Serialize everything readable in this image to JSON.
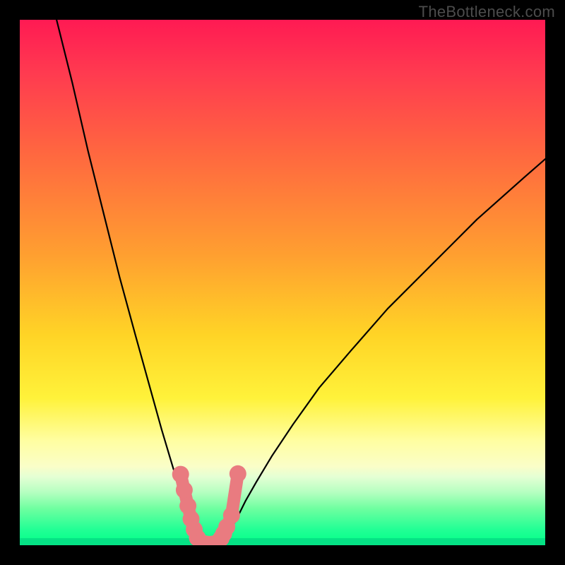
{
  "watermark": {
    "text": "TheBottleneck.com"
  },
  "chart_data": {
    "type": "line",
    "title": "",
    "xlabel": "",
    "ylabel": "",
    "xlim": [
      0,
      100
    ],
    "ylim": [
      0,
      100
    ],
    "series": [
      {
        "name": "curve-left",
        "x": [
          7,
          10,
          13,
          16,
          19,
          22,
          24.5,
          27,
          28.5,
          30,
          31.2,
          32.2,
          32.9,
          33.3
        ],
        "y": [
          100,
          88,
          75,
          63,
          51,
          40,
          31,
          22,
          17,
          12,
          7,
          4,
          1.5,
          0.2
        ],
        "style": "black-thin"
      },
      {
        "name": "curve-right",
        "x": [
          38.7,
          39.3,
          40.2,
          41.5,
          43.0,
          45.0,
          48.0,
          52.0,
          57.0,
          63.0,
          70.0,
          78.0,
          87.0,
          96.0,
          100.0
        ],
        "y": [
          0.2,
          1.3,
          3.0,
          5.5,
          8.5,
          12.0,
          17.0,
          23.0,
          30.0,
          37.0,
          45.0,
          53.0,
          62.0,
          70.0,
          73.5
        ],
        "style": "black-thin"
      },
      {
        "name": "valley-highlight",
        "x": [
          30.6,
          31.3,
          32.0,
          32.6,
          33.2,
          33.8,
          34.6,
          35.6,
          36.6,
          37.6,
          38.3,
          38.8,
          39.4,
          40.3,
          41.5
        ],
        "y": [
          13.5,
          10.5,
          7.5,
          5.0,
          3.0,
          1.4,
          0.5,
          0.2,
          0.2,
          0.5,
          1.3,
          2.2,
          3.5,
          5.7,
          13.6
        ],
        "style": "salmon-dots"
      }
    ],
    "background": {
      "type": "vertical-gradient",
      "stops": [
        {
          "pos": 0.0,
          "color": "#ff1a53"
        },
        {
          "pos": 0.25,
          "color": "#ff6640"
        },
        {
          "pos": 0.6,
          "color": "#ffd426"
        },
        {
          "pos": 0.8,
          "color": "#fffea0"
        },
        {
          "pos": 0.9,
          "color": "#b4ffc0"
        },
        {
          "pos": 1.0,
          "color": "#05e285"
        }
      ]
    }
  }
}
